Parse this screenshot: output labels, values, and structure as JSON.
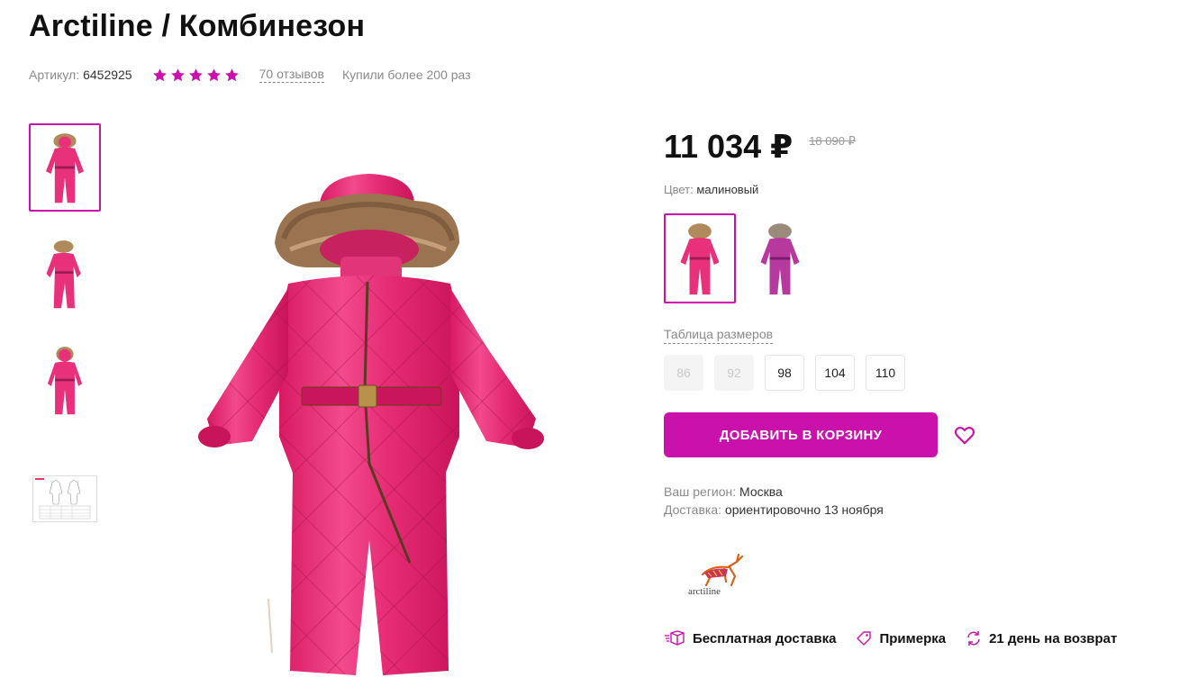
{
  "product": {
    "title": "Arctiline / Комбинезон",
    "sku_label": "Артикул:",
    "sku_value": "6452925",
    "rating_stars": 5,
    "reviews_link": "70 отзывов",
    "bought_text": "Купили более 200 раз"
  },
  "price": {
    "current": "11 034 ₽",
    "old": "18 090 ₽"
  },
  "color": {
    "label": "Цвет:",
    "value": "малиновый"
  },
  "sizes": {
    "table_link": "Таблица размеров",
    "options": [
      {
        "label": "86",
        "available": false
      },
      {
        "label": "92",
        "available": false
      },
      {
        "label": "98",
        "available": true
      },
      {
        "label": "104",
        "available": true
      },
      {
        "label": "110",
        "available": true
      }
    ]
  },
  "cart": {
    "add_label": "ДОБАВИТЬ В КОРЗИНУ"
  },
  "delivery": {
    "region_label": "Ваш регион:",
    "region_value": "Москва",
    "delivery_label": "Доставка:",
    "delivery_value": "ориентировочно 13 ноября"
  },
  "brand": {
    "logo_text": "arctiline"
  },
  "features": [
    {
      "icon": "box-icon",
      "label": "Бесплатная доставка"
    },
    {
      "icon": "tag-icon",
      "label": "Примерка"
    },
    {
      "icon": "return-icon",
      "label": "21 день на возврат"
    }
  ],
  "colors": {
    "accent": "#cb11ab",
    "suit_main": "#e8317a",
    "suit_alt": "#b8399e",
    "star": "#cb11ab"
  }
}
